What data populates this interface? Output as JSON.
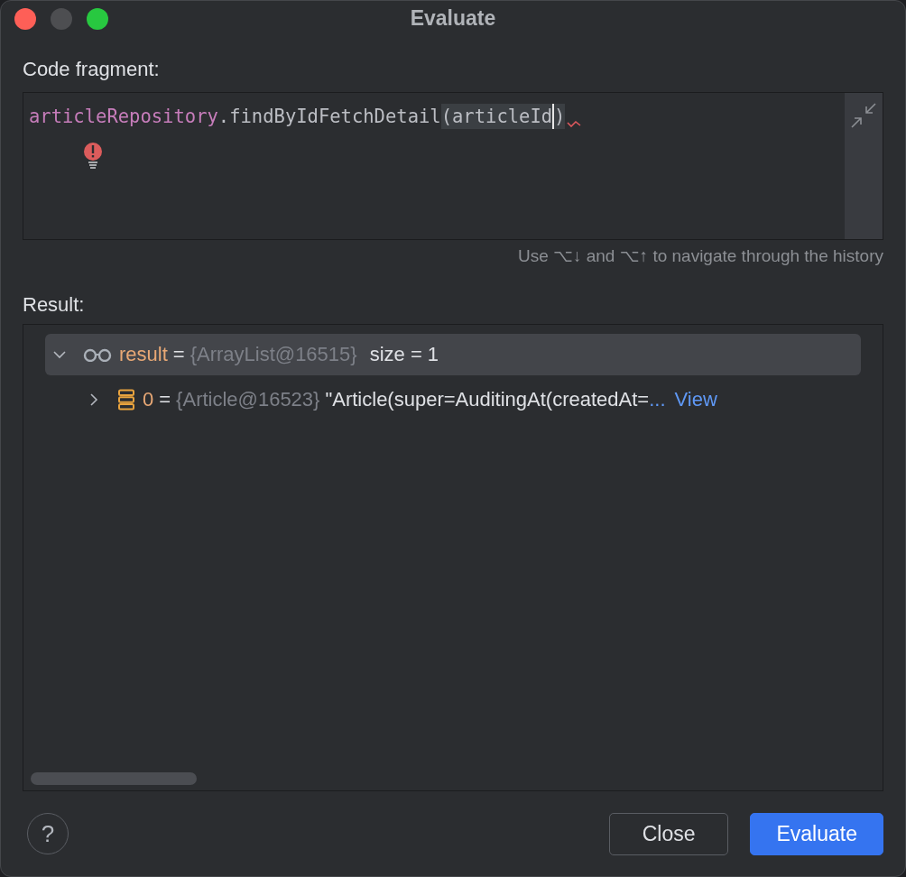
{
  "window": {
    "title": "Evaluate",
    "controls": [
      {
        "kind": "close"
      },
      {
        "kind": "inactive"
      },
      {
        "kind": "zoom"
      }
    ]
  },
  "code_fragment": {
    "label": "Code fragment:",
    "tokens": [
      {
        "text": "articleRepository",
        "kind": "field"
      },
      {
        "text": ".findByIdFetchDetail",
        "kind": "plain"
      },
      {
        "text": "(articleId",
        "kind": "matched"
      },
      {
        "text": ")",
        "kind": "caret"
      }
    ],
    "error": true,
    "hint": "Use ⌥↓ and ⌥↑ to navigate through the history"
  },
  "result": {
    "label": "Result:",
    "tree": [
      {
        "kind": "list",
        "name": "result",
        "operator": "=",
        "type": "{ArrayList@16515}",
        "value": "size = 1",
        "expanded": true,
        "selected": true,
        "children": [
          {
            "kind": "object",
            "name": "0",
            "operator": "=",
            "type": "{Article@16523}",
            "value": "\"Article(super=AuditingAt(createdAt=",
            "ellipsis": "...",
            "link": "View",
            "expanded": false,
            "selected": false
          }
        ]
      }
    ]
  },
  "help": "?",
  "buttons": [
    {
      "label": "Close",
      "kind": "secondary"
    },
    {
      "label": "Evaluate",
      "kind": "primary"
    }
  ]
}
